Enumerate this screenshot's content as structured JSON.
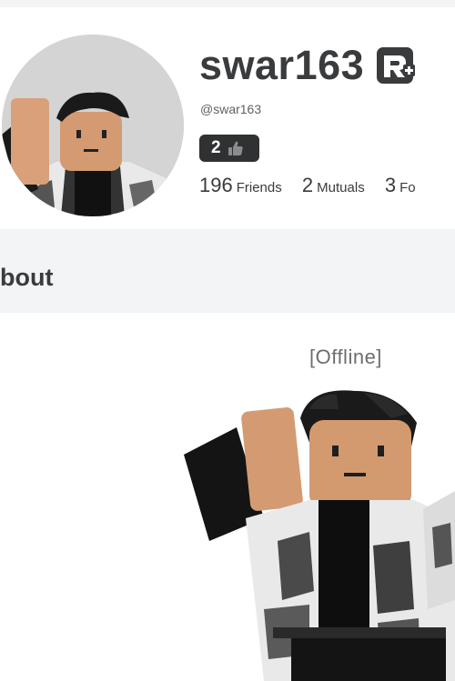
{
  "profile": {
    "display_name": "swar163",
    "handle": "@swar163",
    "badge_count": "2",
    "premium_icon": "premium-r-plus-icon",
    "badge_icon": "thumbs-up-icon"
  },
  "stats": [
    {
      "count": "196",
      "label": "Friends"
    },
    {
      "count": "2",
      "label": "Mutuals"
    },
    {
      "count": "3",
      "label": "Fo"
    }
  ],
  "about": {
    "title": "bout"
  },
  "avatar_view": {
    "status": "[Offline]"
  },
  "colors": {
    "page_bg": "#ffffff",
    "band_bg": "#f2f4f5",
    "text": "#393b3d",
    "badge_bg": "#2f3133",
    "avatar_bg": "#d4d4d4"
  }
}
